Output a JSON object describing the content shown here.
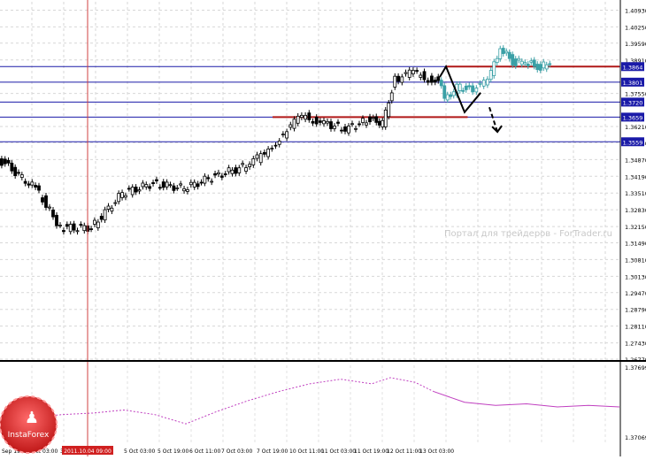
{
  "chart_data": [
    {
      "type": "candlestick",
      "pane": "price",
      "ylim": [
        1.2677,
        1.4127
      ],
      "x_ticks": [
        "Sep 1900",
        "3 Oct 03:00",
        "3",
        "5 Oct 03:00",
        "5 Oct 19:00",
        "6 Oct 11:00",
        "7 Oct 03:00",
        "7 Oct 19:00",
        "10 Oct 11:00",
        "11 Oct 03:00",
        "11 Oct 19:00",
        "12 Oct 11:00",
        "13 Oct 03:00"
      ],
      "y_ticks": [
        "1.40930",
        "1.40250",
        "1.39590",
        "1.38910",
        "1.37550",
        "1.36210",
        "1.35550",
        "1.34870",
        "1.34190",
        "1.33510",
        "1.32830",
        "1.32150",
        "1.31490",
        "1.30810",
        "1.30130",
        "1.29470",
        "1.28790",
        "1.28110",
        "1.27430",
        "1.26770"
      ],
      "marker_label": "2011.10.04 09:00",
      "watermark": "Портал для трейдеров - ForTrader.ru",
      "grid": true,
      "horizontal_levels": [
        {
          "price": 1.3864,
          "label": "1.3864",
          "color": "#1a1aa8"
        },
        {
          "price": 1.3801,
          "label": "1.3801",
          "color": "#1a1aa8"
        },
        {
          "price": 1.372,
          "label": "1.3720",
          "color": "#1a1aa8"
        },
        {
          "price": 1.3659,
          "label": "1.3659",
          "color": "#1a1aa8"
        },
        {
          "price": 1.3559,
          "label": "1.3559",
          "color": "#1a1aa8"
        }
      ],
      "resistance_lines": [
        {
          "price": 1.3864,
          "x_from": 0.72,
          "x_to": 1.0,
          "color": "#b01818"
        },
        {
          "price": 1.3659,
          "x_from": 0.44,
          "x_to": 0.755,
          "color": "#b01818"
        }
      ],
      "forecast_path": [
        [
          0.71,
          1.3822
        ],
        [
          0.72,
          1.3864
        ],
        [
          0.75,
          1.3679
        ],
        [
          0.776,
          1.3758
        ],
        [
          0.79,
          1.3699
        ],
        [
          0.803,
          1.3599
        ]
      ],
      "series": [
        {
          "segment": "history",
          "color": "#000000",
          "points": [
            [
              0.0,
              1.349
            ],
            [
              0.06,
              1.337
            ],
            [
              0.1,
              1.321
            ],
            [
              0.15,
              1.321
            ],
            [
              0.2,
              1.335
            ],
            [
              0.25,
              1.339
            ],
            [
              0.3,
              1.337
            ],
            [
              0.35,
              1.342
            ],
            [
              0.4,
              1.346
            ],
            [
              0.43,
              1.351
            ],
            [
              0.46,
              1.359
            ],
            [
              0.49,
              1.3665
            ],
            [
              0.52,
              1.364
            ],
            [
              0.56,
              1.361
            ],
            [
              0.6,
              1.365
            ],
            [
              0.62,
              1.363
            ],
            [
              0.64,
              1.381
            ],
            [
              0.67,
              1.384
            ],
            [
              0.7,
              1.381
            ],
            [
              0.71,
              1.3822
            ]
          ]
        },
        {
          "segment": "actual",
          "color": "#3ba0a6",
          "points": [
            [
              0.71,
              1.3822
            ],
            [
              0.72,
              1.372
            ],
            [
              0.74,
              1.378
            ],
            [
              0.76,
              1.377
            ],
            [
              0.79,
              1.38
            ],
            [
              0.8,
              1.387
            ],
            [
              0.81,
              1.395
            ],
            [
              0.83,
              1.388
            ],
            [
              0.85,
              1.389
            ],
            [
              0.87,
              1.386
            ],
            [
              0.89,
              1.388
            ]
          ]
        }
      ]
    },
    {
      "type": "line",
      "pane": "indicator",
      "ylim": [
        1.35,
        1.4
      ],
      "y_ticks": [
        "1.37699",
        "1.37069"
      ],
      "series": [
        {
          "color": "#c040c0",
          "points": [
            [
              0.0,
              1.362
            ],
            [
              0.05,
              1.366
            ],
            [
              0.1,
              1.368
            ],
            [
              0.15,
              1.369
            ],
            [
              0.2,
              1.371
            ],
            [
              0.25,
              1.368
            ],
            [
              0.3,
              1.362
            ],
            [
              0.35,
              1.37
            ],
            [
              0.4,
              1.377
            ],
            [
              0.45,
              1.383
            ],
            [
              0.5,
              1.388
            ],
            [
              0.55,
              1.391
            ],
            [
              0.6,
              1.388
            ],
            [
              0.63,
              1.392
            ],
            [
              0.67,
              1.389
            ],
            [
              0.7,
              1.383
            ],
            [
              0.75,
              1.376
            ],
            [
              0.8,
              1.374
            ],
            [
              0.85,
              1.375
            ],
            [
              0.9,
              1.373
            ],
            [
              0.95,
              1.374
            ],
            [
              1.0,
              1.373
            ]
          ]
        }
      ]
    }
  ],
  "logo": {
    "text": "InstaForex"
  }
}
